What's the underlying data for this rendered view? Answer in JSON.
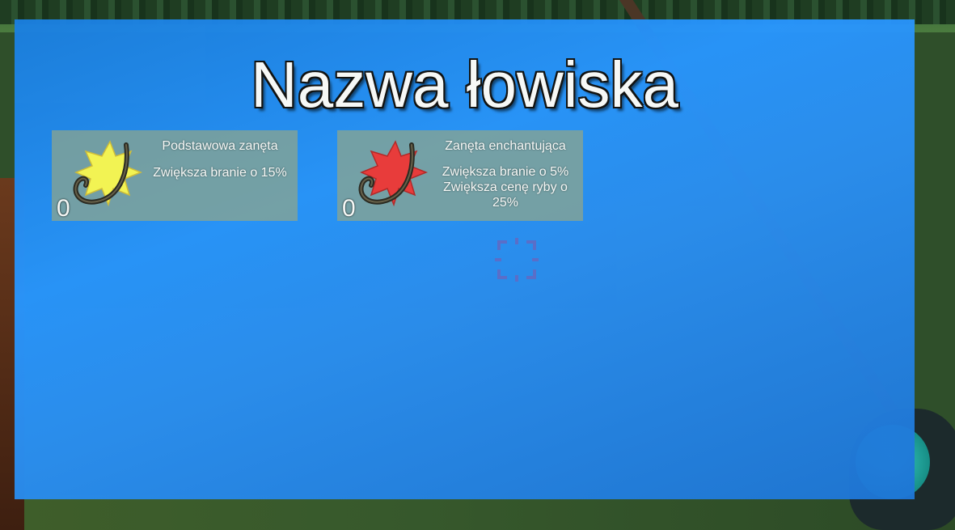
{
  "screen": {
    "title": "Nazwa łowiska"
  },
  "baits": [
    {
      "name": "Podstawowa zanęta",
      "description": "Zwiększa branie o 15%",
      "count": "0",
      "icon": "yellow-star-hook-icon",
      "color": "#fafa55"
    },
    {
      "name": "Zanęta enchantująca",
      "description": "Zwiększa branie o 5% Zwiększa cenę ryby o 25%",
      "count": "0",
      "icon": "red-star-hook-icon",
      "color": "#f03c3c"
    }
  ],
  "colors": {
    "overlay": "#2890f5",
    "card": "#96aa8c",
    "crosshair": "#5a6ec8"
  },
  "icons": {
    "crosshair": "crosshair-icon"
  }
}
